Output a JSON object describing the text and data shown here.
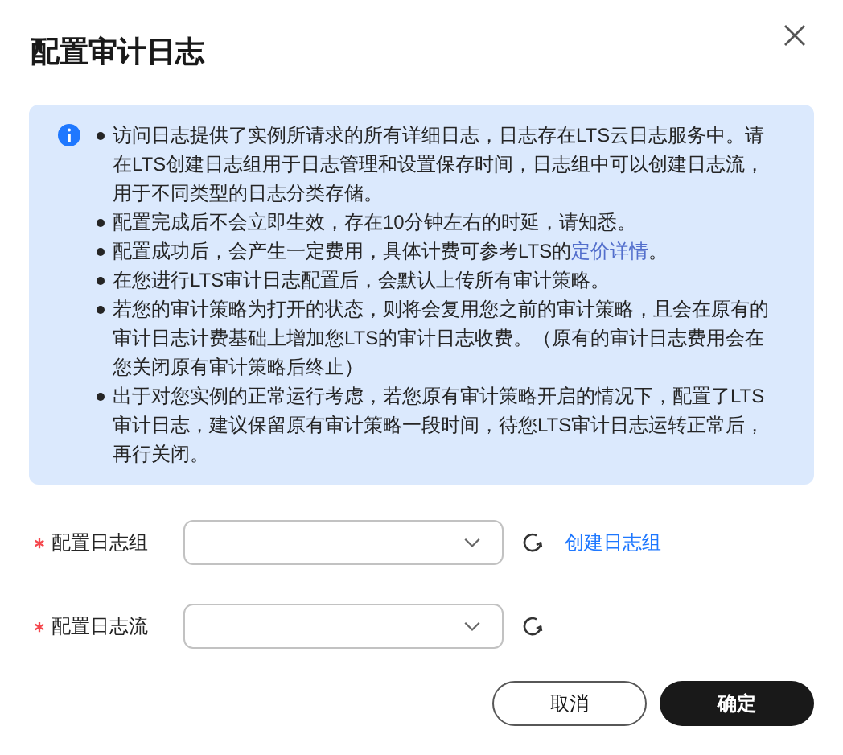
{
  "dialog": {
    "title": "配置审计日志"
  },
  "notice": {
    "items": [
      {
        "text": "访问日志提供了实例所请求的所有详细日志，日志存在LTS云日志服务中。请在LTS创建日志组用于日志管理和设置保存时间，日志组中可以创建日志流，用于不同类型的日志分类存储。"
      },
      {
        "text": "配置完成后不会立即生效，存在10分钟左右的时延，请知悉。"
      },
      {
        "text": "配置成功后，会产生一定费用，具体计费可参考LTS的",
        "link": "定价详情",
        "after": "。"
      },
      {
        "text": "在您进行LTS审计日志配置后，会默认上传所有审计策略。"
      },
      {
        "text": "若您的审计策略为打开的状态，则将会复用您之前的审计策略，且会在原有的审计日志计费基础上增加您LTS的审计日志收费。（原有的审计日志费用会在您关闭原有审计策略后终止）"
      },
      {
        "text": "出于对您实例的正常运行考虑，若您原有审计策略开启的情况下，配置了LTS审计日志，建议保留原有审计策略一段时间，待您LTS审计日志运转正常后，再行关闭。"
      }
    ]
  },
  "fields": [
    {
      "label": "配置日志组",
      "required": true,
      "link": "创建日志组"
    },
    {
      "label": "配置日志流",
      "required": true
    }
  ],
  "buttons": [
    {
      "label": "取消",
      "kind": "secondary"
    },
    {
      "label": "确定",
      "kind": "primary"
    }
  ]
}
